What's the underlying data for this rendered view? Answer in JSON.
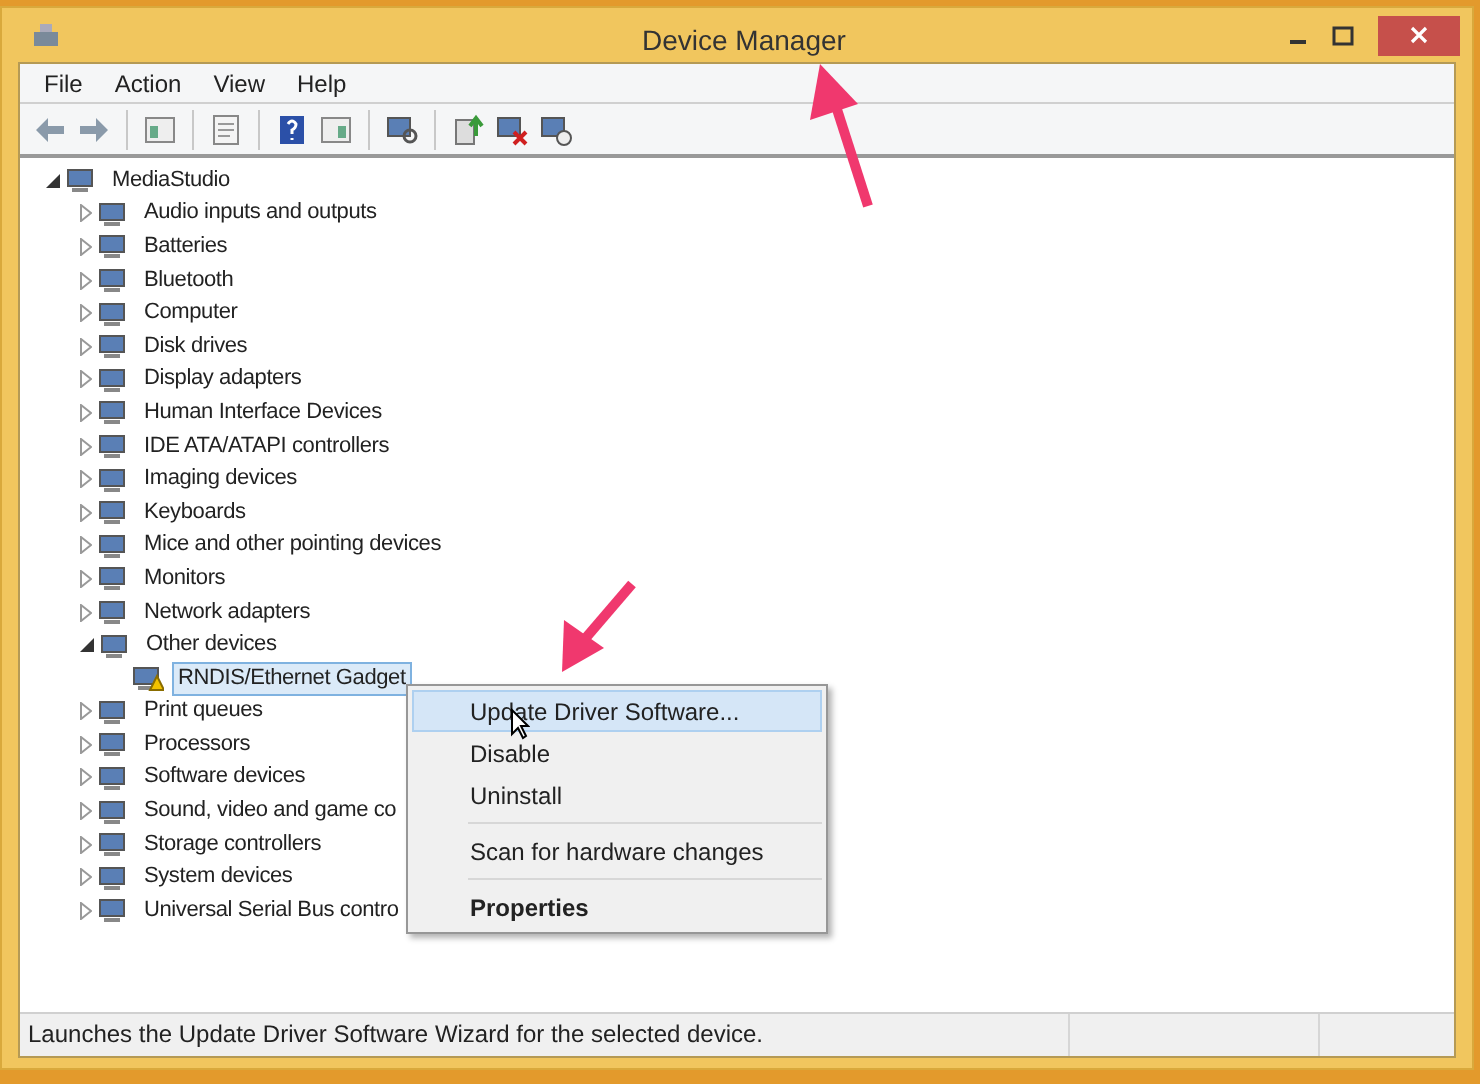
{
  "window": {
    "title": "Device Manager"
  },
  "menu_bar": [
    "File",
    "Action",
    "View",
    "Help"
  ],
  "tree": {
    "label": "MediaStudio",
    "expanded": true,
    "selected": false,
    "children": [
      {
        "label": "Audio inputs and outputs",
        "expanded": false,
        "selected": false
      },
      {
        "label": "Batteries",
        "expanded": false,
        "selected": false
      },
      {
        "label": "Bluetooth",
        "expanded": false,
        "selected": false
      },
      {
        "label": "Computer",
        "expanded": false,
        "selected": false
      },
      {
        "label": "Disk drives",
        "expanded": false,
        "selected": false
      },
      {
        "label": "Display adapters",
        "expanded": false,
        "selected": false
      },
      {
        "label": "Human Interface Devices",
        "expanded": false,
        "selected": false
      },
      {
        "label": "IDE ATA/ATAPI controllers",
        "expanded": false,
        "selected": false
      },
      {
        "label": "Imaging devices",
        "expanded": false,
        "selected": false
      },
      {
        "label": "Keyboards",
        "expanded": false,
        "selected": false
      },
      {
        "label": "Mice and other pointing devices",
        "expanded": false,
        "selected": false
      },
      {
        "label": "Monitors",
        "expanded": false,
        "selected": false
      },
      {
        "label": "Network adapters",
        "expanded": false,
        "selected": false
      },
      {
        "label": "Other devices",
        "expanded": true,
        "selected": false,
        "children": [
          {
            "label": "RNDIS/Ethernet Gadget",
            "selected": true,
            "warning": true
          }
        ]
      },
      {
        "label": "Print queues",
        "expanded": false,
        "selected": false
      },
      {
        "label": "Processors",
        "expanded": false,
        "selected": false
      },
      {
        "label": "Software devices",
        "expanded": false,
        "selected": false
      },
      {
        "label": "Sound, video and game co",
        "expanded": false,
        "selected": false
      },
      {
        "label": "Storage controllers",
        "expanded": false,
        "selected": false
      },
      {
        "label": "System devices",
        "expanded": false,
        "selected": false
      },
      {
        "label": "Universal Serial Bus contro",
        "expanded": false,
        "selected": false
      }
    ]
  },
  "context_menu": [
    {
      "kind": "item",
      "label": "Update Driver Software...",
      "selected": true,
      "default": false
    },
    {
      "kind": "item",
      "label": "Disable",
      "selected": false,
      "default": false
    },
    {
      "kind": "item",
      "label": "Uninstall",
      "selected": false,
      "default": false
    },
    {
      "kind": "separator"
    },
    {
      "kind": "item",
      "label": "Scan for hardware changes",
      "selected": false,
      "default": false
    },
    {
      "kind": "separator"
    },
    {
      "kind": "item",
      "label": "Properties",
      "selected": false,
      "default": true
    }
  ],
  "status_bar": "Launches the Update Driver Software Wizard for the selected device."
}
